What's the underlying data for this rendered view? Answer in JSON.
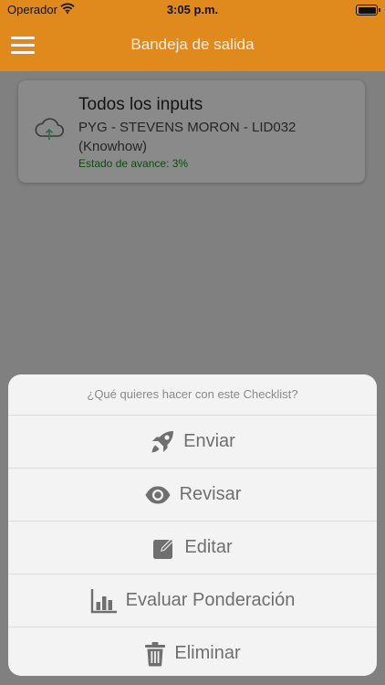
{
  "status_bar": {
    "carrier": "Operador",
    "time": "3:05 p.m."
  },
  "nav": {
    "title": "Bandeja de salida"
  },
  "card": {
    "title": "Todos los inputs",
    "subtitle": "PYG - STEVENS MORON - LID032 (Knowhow)",
    "status": "Estado de avance: 3%"
  },
  "action_sheet": {
    "prompt": "¿Qué quieres hacer con este Checklist?",
    "actions": [
      {
        "label": "Enviar",
        "icon": "rocket-icon"
      },
      {
        "label": "Revisar",
        "icon": "eye-icon"
      },
      {
        "label": "Editar",
        "icon": "edit-icon"
      },
      {
        "label": "Evaluar Ponderación",
        "icon": "bar-chart-icon"
      },
      {
        "label": "Eliminar",
        "icon": "trash-icon"
      }
    ]
  },
  "colors": {
    "brand": "#e08a1e",
    "overlay": "#808080",
    "status_green": "#0b4d0b"
  }
}
